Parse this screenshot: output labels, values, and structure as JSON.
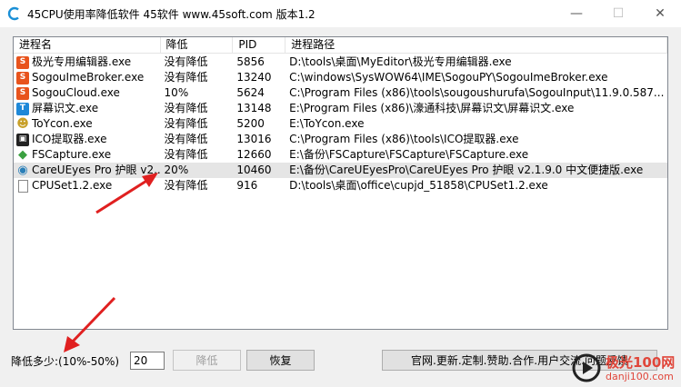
{
  "window": {
    "title": "45CPU使用率降低软件 45软件 www.45soft.com 版本1.2",
    "min_glyph": "—",
    "max_glyph": "☐",
    "close_glyph": "✕"
  },
  "table": {
    "columns": [
      "进程名",
      "降低",
      "PID",
      "进程路径"
    ],
    "rows": [
      {
        "icon": "sogou-s-icon",
        "color": "#e8531c",
        "glyph": "S",
        "name": "极光专用编辑器.exe",
        "reduce": "没有降低",
        "pid": "5856",
        "path": "D:\\tools\\桌面\\MyEditor\\极光专用编辑器.exe"
      },
      {
        "icon": "sogou-s-icon",
        "color": "#e8531c",
        "glyph": "S",
        "name": "SogouImeBroker.exe",
        "reduce": "没有降低",
        "pid": "13240",
        "path": "C:\\windows\\SysWOW64\\IME\\SogouPY\\SogouImeBroker.exe"
      },
      {
        "icon": "sogou-s-icon",
        "color": "#e8531c",
        "glyph": "S",
        "name": "SogouCloud.exe",
        "reduce": "10%",
        "pid": "5624",
        "path": "C:\\Program Files (x86)\\tools\\sougoushurufa\\SogouInput\\11.9.0.587..."
      },
      {
        "icon": "screen-text-icon",
        "color": "#1e88d8",
        "glyph": "T",
        "name": "屏幕识文.exe",
        "reduce": "没有降低",
        "pid": "13148",
        "path": "E:\\Program Files (x86)\\濠通科技\\屏幕识文\\屏幕识文.exe"
      },
      {
        "icon": "toycon-icon",
        "color": "#c8a028",
        "glyph": "☻",
        "name": "ToYcon.exe",
        "reduce": "没有降低",
        "pid": "5200",
        "path": "E:\\ToYcon.exe"
      },
      {
        "icon": "ico-extract-icon",
        "color": "#222222",
        "glyph": "▣",
        "name": "ICO提取器.exe",
        "reduce": "没有降低",
        "pid": "13016",
        "path": "C:\\Program Files (x86)\\tools\\ICO提取器.exe"
      },
      {
        "icon": "fscapture-icon",
        "color": "#3aa040",
        "glyph": "◆",
        "name": "FSCapture.exe",
        "reduce": "没有降低",
        "pid": "12660",
        "path": "E:\\备份\\FSCapture\\FSCapture\\FSCapture.exe"
      },
      {
        "icon": "eye-icon",
        "color": "#2a7fb8",
        "glyph": "◉",
        "name": "CareUEyes Pro 护眼 v2...",
        "reduce": "20%",
        "pid": "10460",
        "path": "E:\\备份\\CareUEyesPro\\CareUEyes Pro 护眼 v2.1.9.0 中文便捷版.exe",
        "selected": true
      },
      {
        "icon": "file-icon",
        "color": "#ffffff",
        "glyph": "",
        "name": "CPUSet1.2.exe",
        "reduce": "没有降低",
        "pid": "916",
        "path": "D:\\tools\\桌面\\office\\cupjd_51858\\CPUSet1.2.exe"
      }
    ]
  },
  "controls": {
    "reduce_label": "降低多少:(10%-50%)",
    "reduce_value": "20",
    "reduce_button": "降低",
    "restore_button": "恢复",
    "official_button": "官网.更新.定制.赞助.合作.用户交流.问题反馈"
  },
  "watermark": {
    "line1": "极光100网",
    "line2": "danji100.com"
  }
}
